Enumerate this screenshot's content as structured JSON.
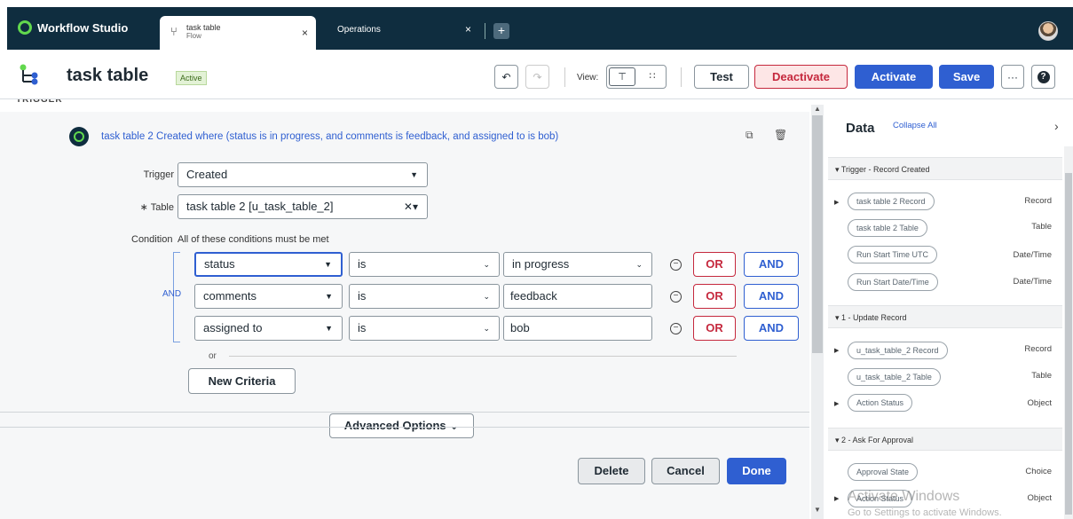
{
  "app": {
    "name": "Workflow Studio"
  },
  "tabs": [
    {
      "title": "task table",
      "subtitle": "Flow",
      "close": "×"
    },
    {
      "title": "Operations",
      "close": "×"
    }
  ],
  "header": {
    "title": "task table",
    "status": "Active",
    "view_label": "View:",
    "test": "Test",
    "deactivate": "Deactivate",
    "activate": "Activate",
    "save": "Save",
    "more": "···",
    "help": "?"
  },
  "section": {
    "label": "TRIGGER"
  },
  "step": {
    "summary": "task table 2 Created where (status is in progress, and comments is feedback, and assigned to is bob)"
  },
  "form": {
    "trigger_label": "Trigger",
    "trigger_value": "Created",
    "table_label": "∗ Table",
    "table_value": "task table 2 [u_task_table_2]",
    "condition_label": "Condition",
    "condition_desc": "All of these conditions must be met",
    "and_label": "AND",
    "or_label": "or",
    "new_criteria": "New Criteria",
    "advanced": "Advanced Options",
    "conditions": [
      {
        "field": "status",
        "op": "is",
        "value": "in progress",
        "or": "OR",
        "and": "AND"
      },
      {
        "field": "comments",
        "op": "is",
        "value": "feedback",
        "or": "OR",
        "and": "AND"
      },
      {
        "field": "assigned to",
        "op": "is",
        "value": "bob",
        "or": "OR",
        "and": "AND"
      }
    ],
    "delete": "Delete",
    "cancel": "Cancel",
    "done": "Done"
  },
  "data_panel": {
    "title": "Data",
    "collapse": "Collapse All",
    "sections": [
      {
        "title": "▾ Trigger - Record Created",
        "items": [
          {
            "pill": "task table 2 Record",
            "type": "Record"
          },
          {
            "pill": "task table 2 Table",
            "type": "Table"
          },
          {
            "pill": "Run Start Time UTC",
            "type": "Date/Time"
          },
          {
            "pill": "Run Start Date/Time",
            "type": "Date/Time"
          }
        ]
      },
      {
        "title": "▾ 1 - Update Record",
        "items": [
          {
            "pill": "u_task_table_2 Record",
            "type": "Record"
          },
          {
            "pill": "u_task_table_2 Table",
            "type": "Table"
          },
          {
            "pill": "Action Status",
            "type": "Object"
          }
        ]
      },
      {
        "title": "▾ 2 - Ask For Approval",
        "items": [
          {
            "pill": "Approval State",
            "type": "Choice"
          },
          {
            "pill": "Action Status",
            "type": "Object"
          }
        ]
      }
    ]
  },
  "watermark": {
    "line1": "Activate Windows",
    "line2": "Go to Settings to activate Windows."
  },
  "colors": {
    "brand_dark": "#0f2d3f",
    "accent_blue": "#2f5fd1",
    "danger": "#c5283d",
    "logo_green": "#62d84e"
  }
}
